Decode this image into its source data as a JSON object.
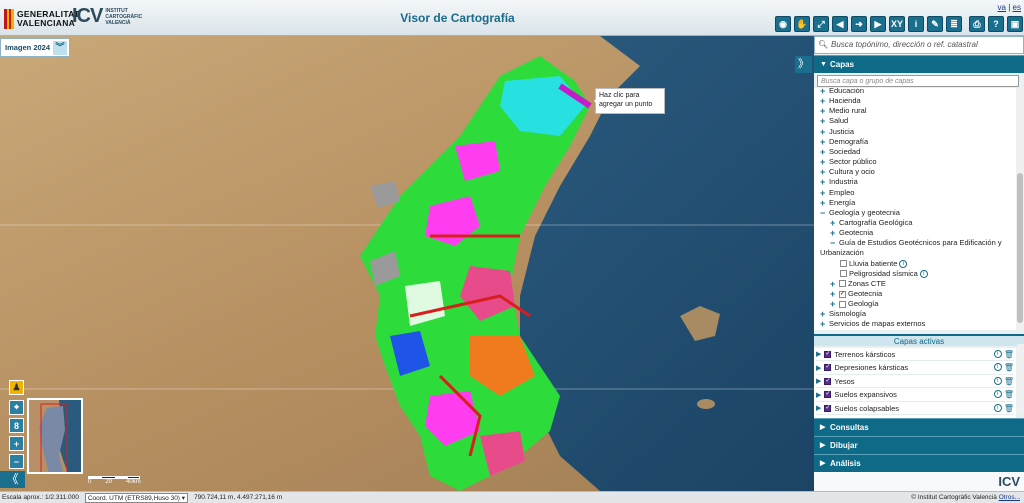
{
  "header": {
    "gva_logo_text": "GENERALITAT VALENCIANA",
    "icv_logo_mark": "ICV",
    "icv_logo_text": "INSTITUT CARTOGRÀFIC VALENCIÀ",
    "title": "Visor de Cartografía",
    "lang_va": "va",
    "lang_sep": "|",
    "lang_es": "es",
    "toolbar": [
      {
        "name": "view-icon",
        "glyph": "◉"
      },
      {
        "name": "pan-hand-icon",
        "glyph": "✋"
      },
      {
        "name": "zoom-full-icon",
        "glyph": "⤢"
      },
      {
        "name": "back-icon",
        "glyph": "◀"
      },
      {
        "name": "forward-icon",
        "glyph": "➜"
      },
      {
        "name": "next-icon",
        "glyph": "▶"
      },
      {
        "name": "xy-icon",
        "glyph": "XY"
      },
      {
        "name": "info-icon",
        "glyph": "i"
      },
      {
        "name": "measure-icon",
        "glyph": "✎"
      },
      {
        "name": "layers-icon",
        "glyph": "≣"
      },
      {
        "name": "print-icon",
        "glyph": "⎙"
      },
      {
        "name": "help-icon",
        "glyph": "?"
      },
      {
        "name": "share-icon",
        "glyph": "▣"
      }
    ]
  },
  "map": {
    "imagery_label": "Imagen 2024",
    "imagery_chevron": "︾",
    "tooltip_line1": "Haz clic para",
    "tooltip_line2": "agregar un punto",
    "collapse_left": "《",
    "scale_labels": [
      "0",
      "20",
      "40km"
    ]
  },
  "left_controls": [
    {
      "name": "pegman-icon",
      "glyph": "♟"
    },
    {
      "name": "locate-icon",
      "glyph": "⌖"
    },
    {
      "name": "zoom-level-indicator",
      "glyph": "8"
    },
    {
      "name": "zoom-in-button",
      "glyph": "+"
    },
    {
      "name": "zoom-out-button",
      "glyph": "−"
    }
  ],
  "status": {
    "scale": "Escala aprox.: 1/2.311.000",
    "crs_select": "Coord. UTM (ETRS89,Huso 30)",
    "coords": "790.724,11 m, 4.497.271,16 m",
    "credit": "© Institut Cartogràfic Valencià",
    "credit_link": "Otros..."
  },
  "panel": {
    "search_placeholder": "Busca topónimo, dirección o ref. catastral",
    "collapse_right": "》",
    "capas_label": "Capas",
    "layer_search_placeholder": "Busca capa o grupo de capas",
    "tree": [
      {
        "label": "Educación",
        "indent": 0,
        "kind": "plus"
      },
      {
        "label": "Hacienda",
        "indent": 0,
        "kind": "plus"
      },
      {
        "label": "Medio rural",
        "indent": 0,
        "kind": "plus"
      },
      {
        "label": "Salud",
        "indent": 0,
        "kind": "plus"
      },
      {
        "label": "Justicia",
        "indent": 0,
        "kind": "plus"
      },
      {
        "label": "Demografía",
        "indent": 0,
        "kind": "plus"
      },
      {
        "label": "Sociedad",
        "indent": 0,
        "kind": "plus"
      },
      {
        "label": "Sector público",
        "indent": 0,
        "kind": "plus"
      },
      {
        "label": "Cultura y ocio",
        "indent": 0,
        "kind": "plus"
      },
      {
        "label": "Industria",
        "indent": 0,
        "kind": "plus"
      },
      {
        "label": "Empleo",
        "indent": 0,
        "kind": "plus"
      },
      {
        "label": "Energía",
        "indent": 0,
        "kind": "plus"
      },
      {
        "label": "Geología y geotecnia",
        "indent": 0,
        "kind": "minus"
      },
      {
        "label": "Cartografía Geológica",
        "indent": 1,
        "kind": "plus"
      },
      {
        "label": "Geotecnia",
        "indent": 1,
        "kind": "plus"
      },
      {
        "label": "Guía de Estudios Geotécnicos para Edificación y",
        "indent": 1,
        "kind": "minus"
      },
      {
        "label": "Urbanización",
        "indent": 0,
        "kind": "none"
      },
      {
        "label": "Lluvia batiente",
        "indent": 2,
        "kind": "check",
        "info": true
      },
      {
        "label": "Peligrosidad sísmica",
        "indent": 2,
        "kind": "check",
        "info": true
      },
      {
        "label": "Zonas CTE",
        "indent": 1,
        "kind": "pluscheck"
      },
      {
        "label": "Geotecnia",
        "indent": 1,
        "kind": "pluscheck-on"
      },
      {
        "label": "Geología",
        "indent": 1,
        "kind": "pluscheck"
      },
      {
        "label": "Sismología",
        "indent": 0,
        "kind": "plus"
      },
      {
        "label": "Servicios de mapas externos",
        "indent": 0,
        "kind": "plus"
      }
    ],
    "active_header": "Capas activas",
    "active_layers": [
      "Terrenos kársticos",
      "Depresiones kársticas",
      "Yesos",
      "Suelos expansivos",
      "Suelos colapsables"
    ],
    "sections": [
      "Consultas",
      "Dibujar",
      "Análisis"
    ]
  },
  "colors": {
    "accent": "#0f6a87",
    "title": "#1a6a8a",
    "sea": "#1e4a6e",
    "land": "#b8966a"
  }
}
